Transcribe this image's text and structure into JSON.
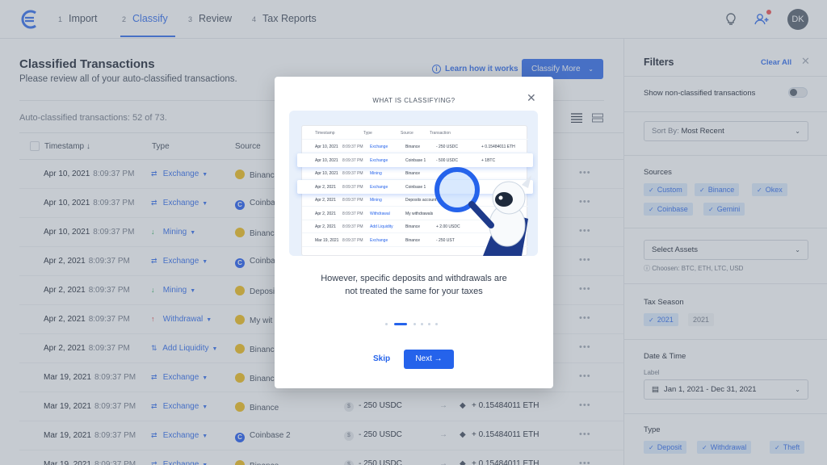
{
  "nav": {
    "steps": [
      {
        "num": "1",
        "label": "Import"
      },
      {
        "num": "2",
        "label": "Classify"
      },
      {
        "num": "3",
        "label": "Review"
      },
      {
        "num": "4",
        "label": "Tax Reports"
      }
    ],
    "active_step": "Classify",
    "avatar_initials": "DK"
  },
  "main": {
    "title": "Classified Transactions",
    "subtitle": "Please review all of your auto-classified transactions.",
    "learn_link": "Learn how it works",
    "classify_button": "Classify More",
    "count_text": "Auto-classified transactions: 52 of 73.",
    "columns": [
      "Timestamp",
      "Type",
      "Source"
    ],
    "rows": [
      {
        "date": "Apr 10, 2021",
        "time": "8:09:37 PM",
        "type": "Exchange",
        "source": "Binance",
        "coin": "binance",
        "amount": "",
        "received": ""
      },
      {
        "date": "Apr 10, 2021",
        "time": "8:09:37 PM",
        "type": "Exchange",
        "source": "Coinbase",
        "coin": "coinbase",
        "amount": "",
        "received": ""
      },
      {
        "date": "Apr 10, 2021",
        "time": "8:09:37 PM",
        "type": "Mining",
        "source": "Binance",
        "coin": "binance",
        "amount": "",
        "received": ""
      },
      {
        "date": "Apr 2, 2021",
        "time": "8:09:37 PM",
        "type": "Exchange",
        "source": "Coinbase",
        "coin": "coinbase",
        "amount": "",
        "received": ""
      },
      {
        "date": "Apr 2, 2021",
        "time": "8:09:37 PM",
        "type": "Mining",
        "source": "Deposit",
        "coin": "binance",
        "amount": "",
        "received": ""
      },
      {
        "date": "Apr 2, 2021",
        "time": "8:09:37 PM",
        "type": "Withdrawal",
        "source": "My wit",
        "coin": "binance",
        "amount": "",
        "received": ""
      },
      {
        "date": "Apr 2, 2021",
        "time": "8:09:37 PM",
        "type": "Add Liquidity",
        "source": "Binance",
        "coin": "binance",
        "amount": "",
        "received": ""
      },
      {
        "date": "Mar 19, 2021",
        "time": "8:09:37 PM",
        "type": "Exchange",
        "source": "Binance",
        "coin": "binance",
        "amount": "",
        "received": ""
      },
      {
        "date": "Mar 19, 2021",
        "time": "8:09:37 PM",
        "type": "Exchange",
        "source": "Binance",
        "coin": "binance",
        "amount": "- 250 USDC",
        "received": "+ 0.15484011 ETH"
      },
      {
        "date": "Mar 19, 2021",
        "time": "8:09:37 PM",
        "type": "Exchange",
        "source": "Coinbase 2",
        "coin": "coinbase",
        "amount": "- 250 USDC",
        "received": "+ 0.15484011 ETH"
      },
      {
        "date": "Mar 19, 2021",
        "time": "8:09:37 PM",
        "type": "Exchange",
        "source": "Binance",
        "coin": "binance",
        "amount": "- 250 USDC",
        "received": "+ 0.15484011 ETH"
      }
    ]
  },
  "filters": {
    "title": "Filters",
    "clear_all": "Clear All",
    "show_non_classified": "Show non-classified transactions",
    "sort_label": "Sort By:",
    "sort_value": "Most Recent",
    "sources_title": "Sources",
    "sources": [
      "Custom",
      "Binance",
      "Okex",
      "Coinbase",
      "Gemini"
    ],
    "select_assets": "Select Assets",
    "assets_hint": "Choosen: BTC, ETH, LTC, USD",
    "tax_season_title": "Tax Season",
    "tax_seasons": [
      "2021",
      "2021"
    ],
    "date_title": "Date & Time",
    "date_label": "Label",
    "date_range": "Jan 1, 2021 - Dec 31, 2021",
    "type_title": "Type",
    "types": [
      "Deposit",
      "Withdrawal",
      "Theft"
    ]
  },
  "modal": {
    "heading": "WHAT IS CLASSIFYING?",
    "body_line1": "However, specific deposits and withdrawals are",
    "body_line2": "not treated the same for your taxes",
    "skip": "Skip",
    "next": "Next",
    "illustration": {
      "header": [
        "Timestamp",
        "Type",
        "Source",
        "Transaction"
      ],
      "rows": [
        {
          "date": "Apr 10, 2021",
          "time": "8:09:37 PM",
          "type": "Exchange",
          "source": "Binance",
          "tx": "- 250 USDC",
          "rx": "+ 0.15484011 ETH"
        },
        {
          "date": "Apr 10, 2021",
          "time": "8:09:37 PM",
          "type": "Exchange",
          "source": "Coinbase 1",
          "tx": "- 500 USDC",
          "rx": "+ 1BTC"
        },
        {
          "date": "Apr 10, 2021",
          "time": "8:09:37 PM",
          "type": "Mining",
          "source": "Binance",
          "tx": "",
          "rx": ""
        },
        {
          "date": "Apr 2, 2021",
          "time": "8:09:37 PM",
          "type": "Exchange",
          "source": "Coinbase 1",
          "tx": "",
          "rx": ""
        },
        {
          "date": "Apr 2, 2021",
          "time": "8:09:37 PM",
          "type": "Mining",
          "source": "Deposits account",
          "tx": "",
          "rx": ""
        },
        {
          "date": "Apr 2, 2021",
          "time": "8:09:37 PM",
          "type": "Withdrawal",
          "source": "My withdrawals",
          "tx": "",
          "rx": ""
        },
        {
          "date": "Apr 2, 2021",
          "time": "8:09:37 PM",
          "type": "Add Liquidity",
          "source": "Binance",
          "tx": "+ 2.00 USDC",
          "rx": ""
        },
        {
          "date": "Mar 19, 2021",
          "time": "8:09:37 PM",
          "type": "Exchange",
          "source": "Binance",
          "tx": "- 250 UST",
          "rx": ""
        }
      ]
    }
  },
  "colors": {
    "accent": "#2563eb",
    "overlay": "#7e8895"
  }
}
